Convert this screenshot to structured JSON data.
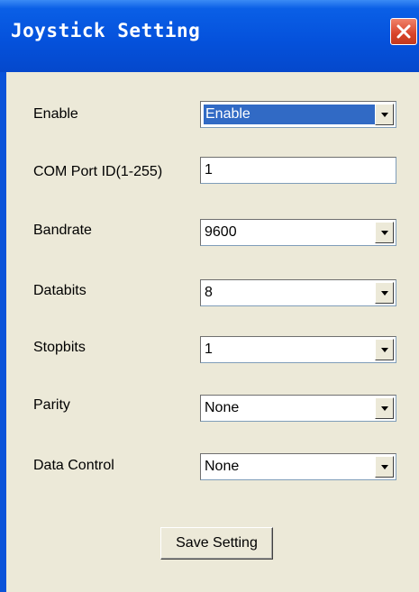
{
  "window": {
    "title": "Joystick Setting"
  },
  "fields": [
    {
      "label": "Enable",
      "value": "Enable",
      "type": "dropdown"
    },
    {
      "label": "COM Port ID(1-255)",
      "value": "1",
      "type": "text"
    },
    {
      "label": "Bandrate",
      "value": "9600",
      "type": "dropdown"
    },
    {
      "label": "Databits",
      "value": "8",
      "type": "dropdown"
    },
    {
      "label": "Stopbits",
      "value": "1",
      "type": "dropdown"
    },
    {
      "label": "Parity",
      "value": "None",
      "type": "dropdown"
    },
    {
      "label": "Data Control",
      "value": "None",
      "type": "dropdown"
    }
  ],
  "buttons": {
    "save_label": "Save Setting"
  },
  "icons": {
    "close": "close-icon",
    "dropdown": "chevron-down-icon"
  },
  "colors": {
    "title_bar": "#0552dc",
    "dialog_bg": "#ece9d8",
    "selection": "#316ac5",
    "close_button": "#d8442a"
  }
}
